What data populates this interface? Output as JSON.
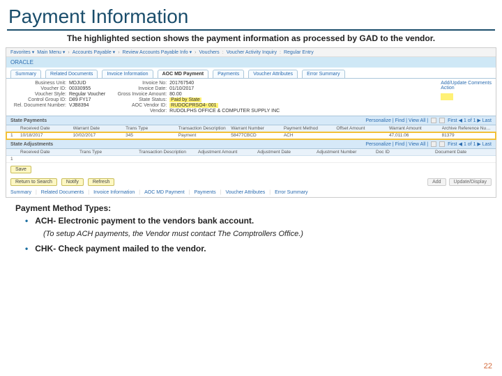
{
  "slide": {
    "title": "Payment Information",
    "subtitle": "The highlighted section shows the payment information as processed by GAD to the vendor.",
    "page_number": "22"
  },
  "menubar": {
    "favorites": "Favorites ▾",
    "main": "Main Menu ▾"
  },
  "breadcrumb": {
    "a": "Accounts Payable ▾",
    "b": "Review Accounts Payable Info ▾",
    "c": "Vouchers",
    "d": "Voucher Activity Inquiry",
    "e": "Regular Entry"
  },
  "bluebar": {
    "text": "ORACLE"
  },
  "tabs": {
    "t0": "Summary",
    "t1": "Related Documents",
    "t2": "Invoice Information",
    "t3": "AOC MD Payment",
    "t4": "Payments",
    "t5": "Voucher Attributes",
    "t6": "Error Summary"
  },
  "details": {
    "bu_l": "Business Unit:",
    "bu_v": "MDJUD",
    "vid_l": "Voucher ID:",
    "vid_v": "00330955",
    "vstyle_l": "Voucher Style:",
    "vstyle_v": "Regular Voucher",
    "cg_l": "Control Group ID:",
    "cg_v": "D89 FY17",
    "rdn_l": "Rel. Document Number:",
    "rdn_v": "VJB8394",
    "invno_l": "Invoice No:",
    "invno_v": "201767540",
    "invdate_l": "Invoice Date:",
    "invdate_v": "01/10/2017",
    "gross_l": "Gross Invoice Amount:",
    "gross_v": "80.00",
    "sst_l": "State Status:",
    "sst_v": "Paid by State",
    "avid_l": "AOC Vendor ID:",
    "avid_v": "RUDOCPRSO4- 001",
    "vend_l": "Vendor:",
    "vend_v": "RUDOLPHS OFFICE & COMPUTER SUPPLY INC",
    "addupd": "Add/Update Comments",
    "action": "Action"
  },
  "state_payments": {
    "title": "State Payments",
    "personalize": "Personalize | Find | View All |",
    "nav": "First ◀ 1 of 1 ▶ Last",
    "h1": "Received Date",
    "h2": "Warrant Date",
    "h3": "Trans Type",
    "h4": "Transaction Description",
    "h5": "Warrant Number",
    "h6": "Payment Method",
    "h7": "Offset Amount",
    "h8": "Warrant Amount",
    "h9": "Archive Reference Number",
    "r1c0": "1",
    "r1c1": "10/18/2017",
    "r1c2": "10/02/2017",
    "r1c3": "345",
    "r1c4": "Payment",
    "r1c5": "58477CBCD",
    "r1c6": "ACH",
    "r1c8": "47,011.06",
    "r1c9": "81379"
  },
  "state_adjustments": {
    "title": "State Adjustments",
    "personalize": "Personalize | Find | View All |",
    "nav": "First ◀ 1 of 1 ▶ Last",
    "h1": "Received Date",
    "h2": "Trans Type",
    "h3": "Transaction Description",
    "h4": "Adjustment Amount",
    "h5": "Adjustment Date",
    "h6": "Adjustment Number",
    "h7": "Doc ID",
    "h8": "Document Date",
    "r1c0": "1"
  },
  "buttons": {
    "save": "Save",
    "return": "Return to Search",
    "notify": "Notify",
    "refresh": "Refresh",
    "add": "Add",
    "update": "Update/Display"
  },
  "bottomlinks": {
    "a": "Summary",
    "b": "Related Documents",
    "c": "Invoice Information",
    "d": "AOC MD Payment",
    "e": "Payments",
    "f": "Voucher Attributes",
    "g": "Error Summary"
  },
  "notes": {
    "hdr": "Payment Method Types:",
    "li1": "ACH- Electronic payment to the vendors bank account.",
    "sub1": "(To setup ACH payments, the Vendor must contact The Comptrollers Office.)",
    "li2": "CHK- Check payment mailed to the vendor."
  }
}
